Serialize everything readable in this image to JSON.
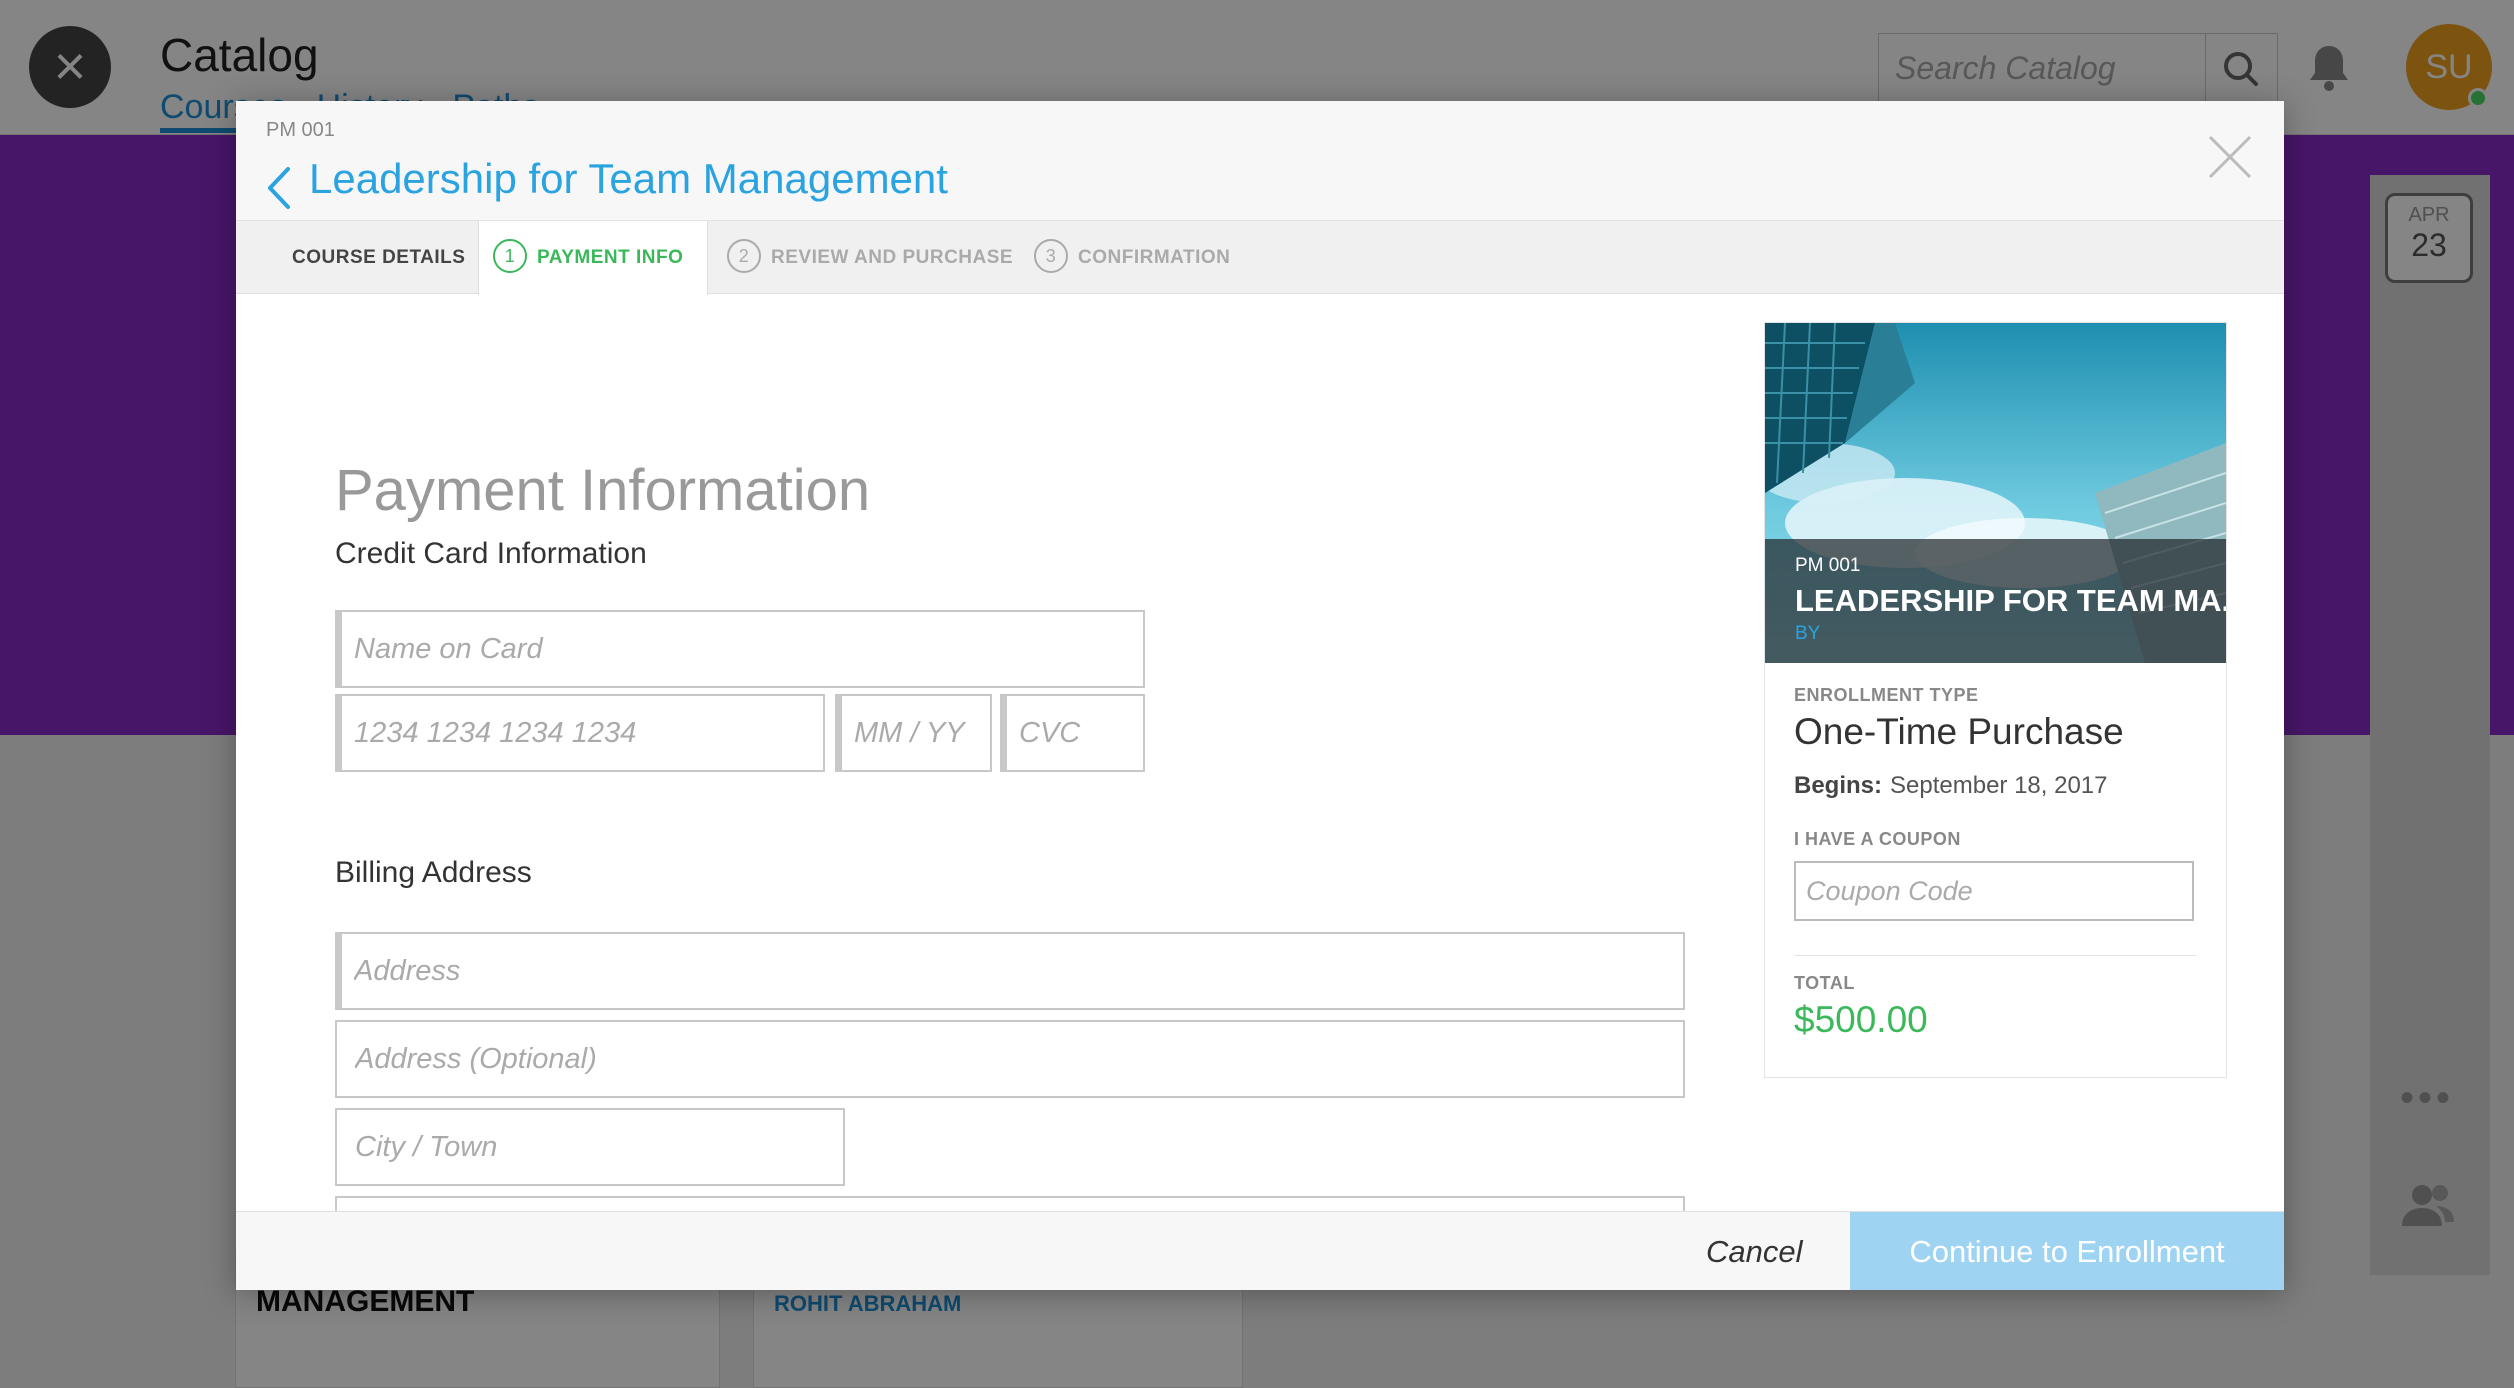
{
  "background": {
    "app_title": "Catalog",
    "tabs": [
      "Courses",
      "History",
      "Paths"
    ],
    "search_placeholder": "Search Catalog",
    "avatar_initials": "SU",
    "calendar_month": "APR",
    "calendar_day": "23",
    "card1_title": "MANAGEMENT",
    "card2_author": "ROHIT ABRAHAM"
  },
  "modal": {
    "course_code": "PM 001",
    "title": "Leadership for Team Management",
    "steps": [
      {
        "label": "COURSE DETAILS",
        "number": ""
      },
      {
        "label": "PAYMENT INFO",
        "number": "1"
      },
      {
        "label": "REVIEW AND PURCHASE",
        "number": "2"
      },
      {
        "label": "CONFIRMATION",
        "number": "3"
      }
    ],
    "active_step": "PAYMENT INFO",
    "form": {
      "heading": "Payment Information",
      "credit_card_heading": "Credit Card Information",
      "name_on_card_placeholder": "Name on Card",
      "card_number_placeholder": "1234 1234 1234 1234",
      "expiry_placeholder": "MM / YY",
      "cvc_placeholder": "CVC",
      "billing_heading": "Billing Address",
      "address_placeholder": "Address",
      "address2_placeholder": "Address (Optional)",
      "city_placeholder": "City / Town"
    },
    "summary": {
      "card_code": "PM 001",
      "card_title": "LEADERSHIP FOR TEAM MA...",
      "card_by": "BY",
      "enrollment_type_label": "ENROLLMENT TYPE",
      "enrollment_type": "One-Time Purchase",
      "begins_label": "Begins:",
      "begins_date": "September 18, 2017",
      "coupon_label": "I HAVE A COUPON",
      "coupon_placeholder": "Coupon Code",
      "total_label": "TOTAL",
      "total": "$500.00"
    },
    "footer": {
      "cancel_label": "Cancel",
      "continue_label": "Continue to Enrollment"
    }
  },
  "colors": {
    "accent_blue": "#2aa3e0",
    "success_green": "#3bb85a",
    "banner_purple": "#8a2bc8",
    "continue_button": "#9fd3f2"
  }
}
